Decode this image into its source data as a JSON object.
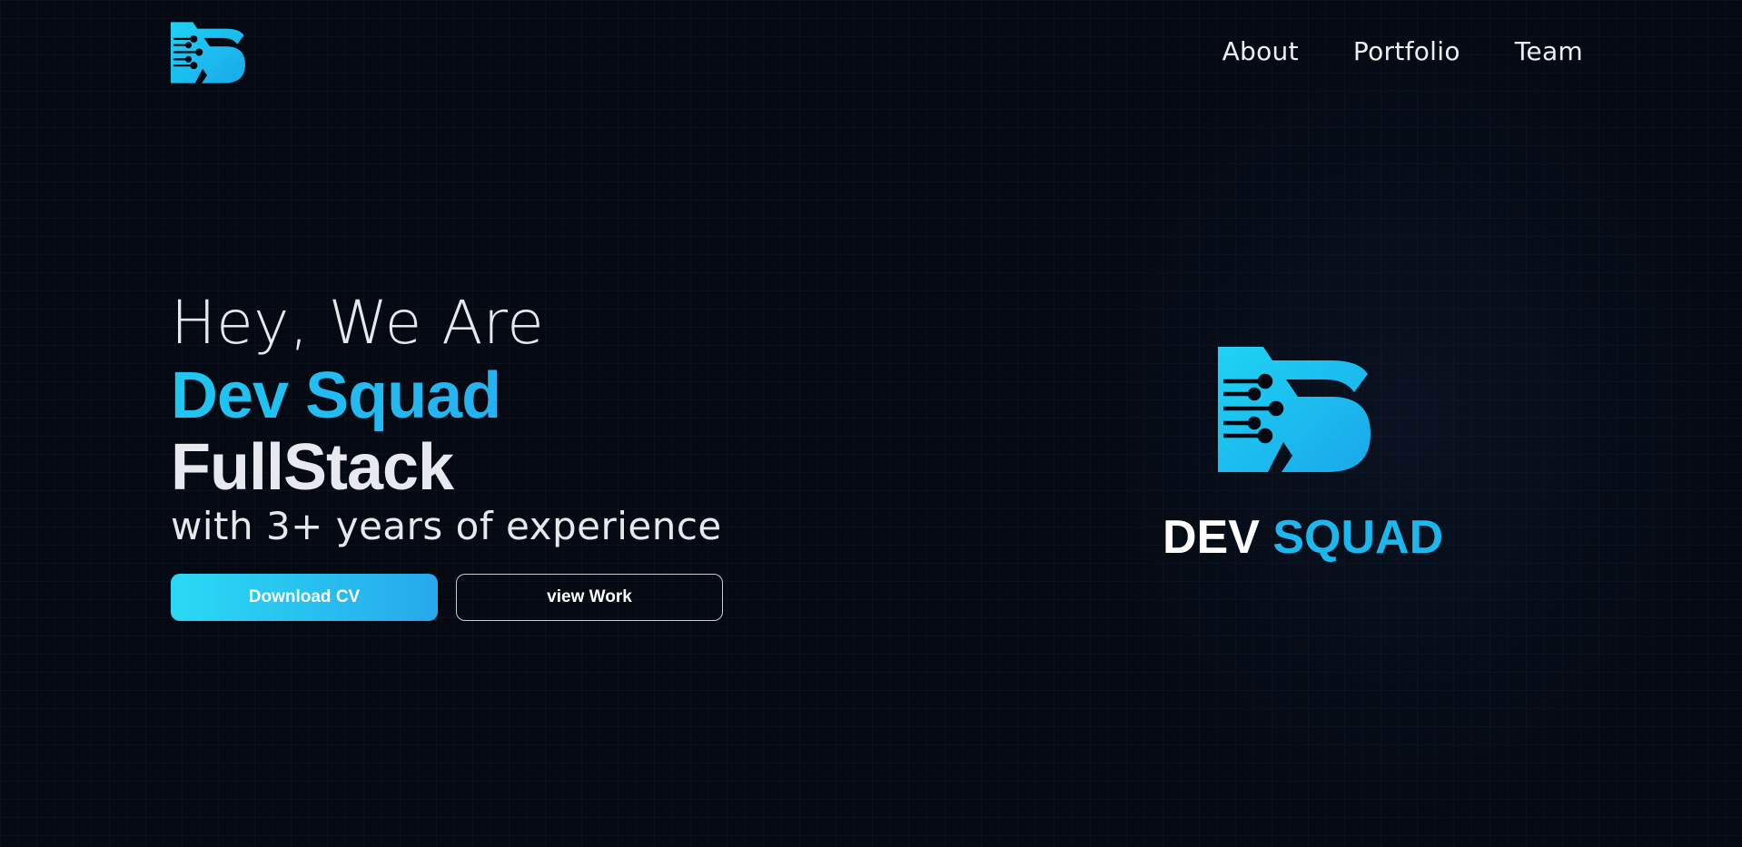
{
  "nav": {
    "logo_icon": "dev-squad-logo-icon",
    "links": [
      {
        "label": "About"
      },
      {
        "label": "Portfolio"
      },
      {
        "label": "Team"
      }
    ]
  },
  "hero": {
    "greeting": "Hey, We Are",
    "name": "Dev Squad",
    "role": "FullStack",
    "experience": "with 3+ years of experience",
    "primary_button": "Download CV",
    "secondary_button": "view Work"
  },
  "brand": {
    "logo_icon": "dev-squad-logo-icon",
    "word_1": "DEV",
    "word_2": "SQUAD"
  },
  "colors": {
    "background": "#050911",
    "accent": "#1ab8ef",
    "accent_light": "#2ad9f4",
    "text": "#eceef2"
  }
}
